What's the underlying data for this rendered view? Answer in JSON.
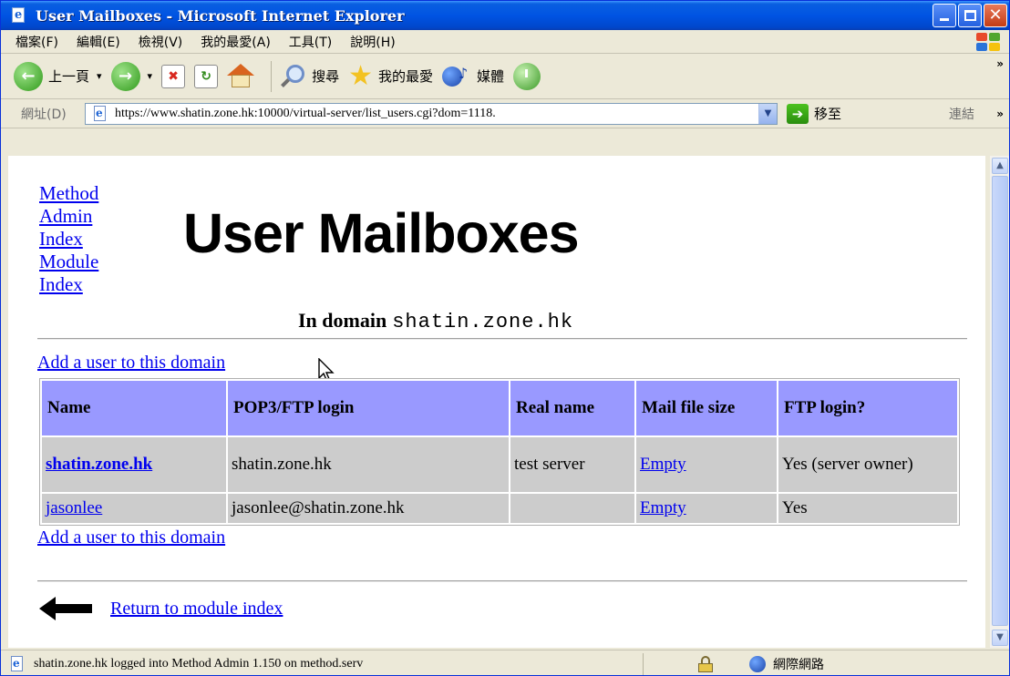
{
  "window": {
    "title": "User Mailboxes - Microsoft Internet Explorer"
  },
  "menu": [
    "檔案(F)",
    "編輯(E)",
    "檢視(V)",
    "我的最愛(A)",
    "工具(T)",
    "說明(H)"
  ],
  "toolbar": {
    "back_label": "上一頁",
    "search_label": "搜尋",
    "favorites_label": "我的最愛",
    "media_label": "媒體"
  },
  "address": {
    "label": "網址(D)",
    "url": "https://www.shatin.zone.hk:10000/virtual-server/list_users.cgi?dom=1118.",
    "go_label": "移至",
    "links_label": "連結"
  },
  "page": {
    "side_links": [
      "Method",
      "Admin",
      "Index",
      "Module",
      "Index"
    ],
    "title": "User Mailboxes",
    "domain_prefix": "In domain",
    "domain_name": "shatin.zone.hk",
    "add_user_link": "Add a user to this domain",
    "table": {
      "headers": [
        "Name",
        "POP3/FTP login",
        "Real name",
        "Mail file size",
        "FTP login?"
      ],
      "rows": [
        {
          "name": "shatin.zone.hk",
          "login": "shatin.zone.hk",
          "real_name": "test server",
          "mail_size": "Empty",
          "ftp": "Yes (server owner)"
        },
        {
          "name": "jasonlee",
          "login": "jasonlee@shatin.zone.hk",
          "real_name": "",
          "mail_size": "Empty",
          "ftp": "Yes"
        }
      ]
    },
    "return_link": "Return to module index"
  },
  "status": {
    "text": "shatin.zone.hk logged into Method Admin 1.150 on method.serv",
    "zone": "網際網路"
  },
  "colors": {
    "header_bg": "#9999ff",
    "cell_bg": "#cccccc",
    "link": "#0000ee"
  }
}
